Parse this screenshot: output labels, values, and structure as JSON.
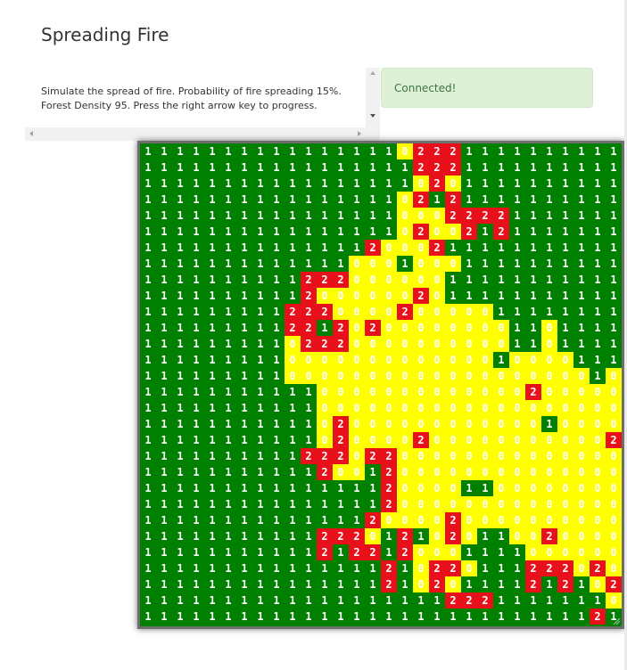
{
  "page": {
    "title": "Spreading Fire",
    "description": "Simulate the spread of fire. Probability of fire spreading 15%. Forest Density 95. Press the right arrow key to progress.",
    "status": "Connected!"
  },
  "board": {
    "cols": 30,
    "rows": 30,
    "legend": {
      "0": "burnt",
      "1": "tree",
      "2": "burning"
    },
    "colors": {
      "0": "#ffff00",
      "1": "#008000",
      "2": "#e8101a",
      "text": "#ffffff"
    },
    "grid": [
      "111111111111111102221111111111",
      "111111111111111112221111111111",
      "111111111111111110201111111111",
      "111111111111111102121111111111",
      "111111111111111100022221111111",
      "111111111111111102002121111111",
      "111111111111112000211111111111",
      "111111111111100010001111111111",
      "111111111122200000011111111111",
      "111111111120000002011111111111",
      "111111111222000020000011111111",
      "111111111221202000000001101111",
      "111111111022200000000001101111",
      "111111111000000000000010000111",
      "111111111000000000000000000010",
      "111111111110000000000000200000",
      "111111111110000000000000000000",
      "111111111110200000000000010000",
      "111111111110200002000000000002",
      "111111111122202200000000000000",
      "111111111112001200000000000000",
      "111111111111111200001100000000",
      "111111111111111200000000000000",
      "111111111111112000020000000000",
      "111111111112220121020110020000",
      "111111111112122120001111000000",
      "111111111111111210220111222020",
      "111111111111111210201111212102",
      "111111111111111111122211111110",
      "111111111111111111111111111121"
    ]
  }
}
